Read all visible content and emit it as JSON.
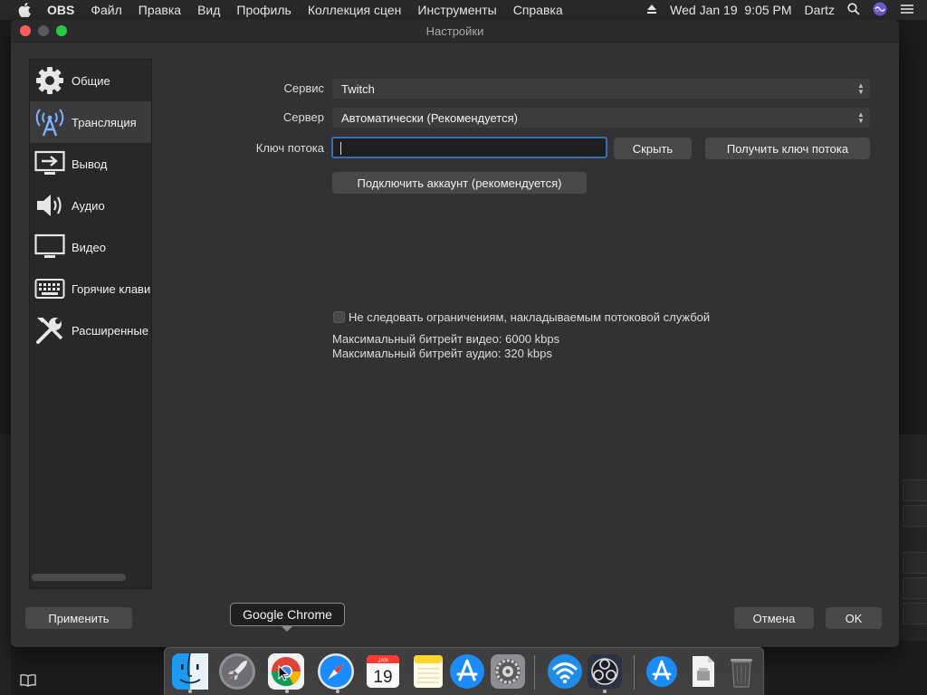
{
  "menubar": {
    "app_name": "OBS",
    "items": [
      "Файл",
      "Правка",
      "Вид",
      "Профиль",
      "Коллекция сцен",
      "Инструменты",
      "Справка"
    ],
    "clock": "Wed Jan 19  9:05 PM",
    "user": "Dartz"
  },
  "window": {
    "title": "Настройки"
  },
  "sidebar": {
    "items": [
      {
        "label": "Общие",
        "icon": "gear-icon"
      },
      {
        "label": "Трансляция",
        "icon": "broadcast-antenna-icon"
      },
      {
        "label": "Вывод",
        "icon": "output-monitor-icon"
      },
      {
        "label": "Аудио",
        "icon": "speaker-icon"
      },
      {
        "label": "Видео",
        "icon": "monitor-icon"
      },
      {
        "label": "Горячие клави",
        "icon": "keyboard-icon"
      },
      {
        "label": "Расширенные",
        "icon": "tools-icon"
      }
    ],
    "active_index": 1
  },
  "stream": {
    "service_label": "Сервис",
    "service_value": "Twitch",
    "server_label": "Сервер",
    "server_value": "Автоматически (Рекомендуется)",
    "key_label": "Ключ потока",
    "key_value": "",
    "hide_button": "Скрыть",
    "get_key_button": "Получить ключ потока",
    "connect_account_button": "Подключить аккаунт (рекомендуется)",
    "ignore_limits_label": "Не следовать ограничениям, накладываемым потоковой службой",
    "ignore_limits_checked": false,
    "max_video_bitrate": "Максимальный битрейт видео: 6000 kbps",
    "max_audio_bitrate": "Максимальный битрейт аудио: 320 kbps"
  },
  "footer": {
    "apply_button": "Применить",
    "cancel_button": "Отмена",
    "ok_button": "OK"
  },
  "tooltip": {
    "text": "Google Chrome"
  },
  "calendar": {
    "month": "JAN",
    "day": "19"
  },
  "dock": {
    "apps": [
      "finder-icon",
      "launchpad-icon",
      "chrome-icon",
      "safari-icon",
      "calendar-icon",
      "notes-icon",
      "app-store-icon",
      "system-preferences-icon",
      "wifi-app-icon",
      "obs-icon",
      "app-store-icon",
      "document-icon",
      "trash-icon"
    ]
  },
  "colors": {
    "accent": "#3b6db0",
    "dialog_bg": "#323234",
    "sidebar_bg": "#28282a"
  }
}
